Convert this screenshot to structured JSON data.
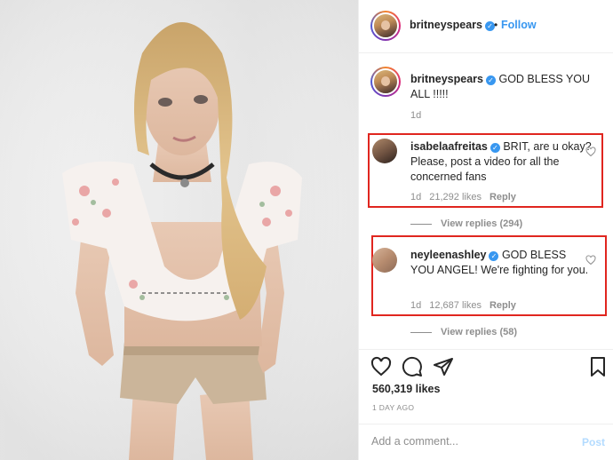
{
  "post": {
    "author": "britneyspears",
    "follow_label": "Follow",
    "separator": "•",
    "caption": "GOD BLESS YOU ALL !!!!!",
    "caption_age": "1d"
  },
  "comments": [
    {
      "username": "isabelaafreitas",
      "text": "BRIT, are u okay? Please, post a video for all the concerned fans",
      "age": "1d",
      "likes": "21,292 likes",
      "reply_label": "Reply",
      "view_replies": "View replies (294)"
    },
    {
      "username": "neyleenashley",
      "text": "GOD BLESS YOU ANGEL! We're fighting for you.",
      "age": "1d",
      "likes": "12,687 likes",
      "reply_label": "Reply",
      "view_replies": "View replies (58)"
    }
  ],
  "footer": {
    "likes": "560,319 likes",
    "date": "1 DAY AGO",
    "comment_placeholder": "Add a comment...",
    "post_label": "Post"
  },
  "icons": {
    "verified": "verified-badge-icon",
    "like": "heart-icon",
    "comment": "comment-bubble-icon",
    "share": "paper-plane-icon",
    "save": "bookmark-icon"
  },
  "colors": {
    "accent": "#3897f0",
    "highlight_border": "#e0261f",
    "muted": "#8e8e8e"
  }
}
